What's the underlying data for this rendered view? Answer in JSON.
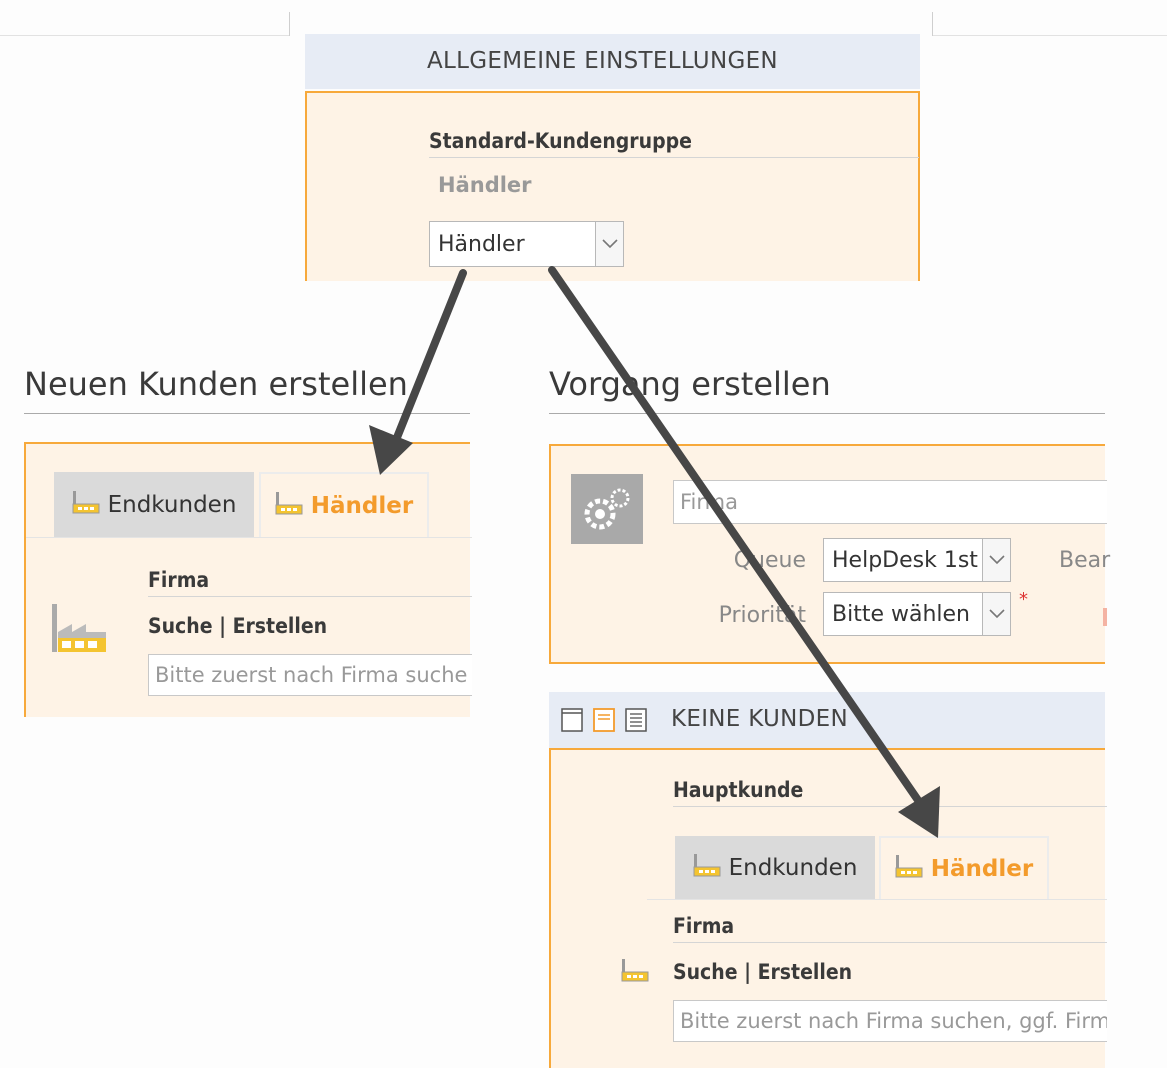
{
  "settings": {
    "header": "ALLGEMEINE EINSTELLUNGEN",
    "field_label": "Standard-Kundengruppe",
    "current_value": "Händler",
    "select_value": "Händler"
  },
  "new_customer": {
    "title": "Neuen Kunden erstellen",
    "tabs": [
      "Endkunden",
      "Händler"
    ],
    "company_label": "Firma",
    "search_create": "Suche | Erstellen",
    "search_placeholder": "Bitte zuerst nach Firma suche"
  },
  "process": {
    "title": "Vorgang erstellen",
    "company_placeholder": "Firma",
    "queue_label": "Queue",
    "queue_value": "HelpDesk 1st",
    "editor_label": "Bear",
    "priority_label": "Priorität",
    "priority_value": "Bitte wählen",
    "required_marker": "*",
    "customers_header": "KEINE KUNDEN",
    "main_customer_label": "Hauptkunde",
    "tabs": [
      "Endkunden",
      "Händler"
    ],
    "company_label": "Firma",
    "search_create": "Suche | Erstellen",
    "search_placeholder": "Bitte zuerst nach Firma suchen, ggf. Firm"
  },
  "icons": {
    "factory": "factory-icon",
    "gears": "gears-icon",
    "chevron": "chevron-down-icon",
    "layout_single": "layout-single-icon",
    "layout_two": "layout-two-column-icon",
    "layout_list": "layout-list-icon",
    "arrow": "arrow-icon"
  },
  "colors": {
    "accent": "#f39b2c",
    "panel_bg": "#fef3e6",
    "panel_border": "#f7a93b",
    "header_bg": "#e7ecf5",
    "tab_inactive": "#dadada",
    "arrow": "#444444"
  }
}
